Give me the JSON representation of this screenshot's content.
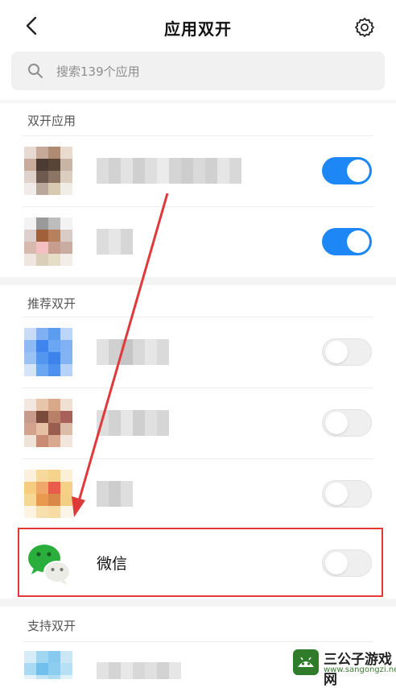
{
  "header": {
    "title": "应用双开",
    "back_icon": "back-icon",
    "settings_icon": "gear-icon"
  },
  "search": {
    "placeholder": "搜索139个应用",
    "icon": "search-icon"
  },
  "sections": [
    {
      "title": "双开应用"
    },
    {
      "title": "推荐双开"
    },
    {
      "title": "支持双开"
    }
  ],
  "apps": {
    "enabled": [
      {
        "name_blurred": true,
        "enabled": true
      },
      {
        "name_blurred": true,
        "enabled": true
      }
    ],
    "recommended": [
      {
        "name_blurred": true,
        "enabled": false
      },
      {
        "name_blurred": true,
        "enabled": false
      },
      {
        "name_blurred": true,
        "enabled": false
      },
      {
        "name": "微信",
        "enabled": false,
        "icon": "wechat-icon"
      }
    ],
    "supported": [
      {
        "name_blurred": true
      }
    ]
  },
  "watermark": {
    "title": "三公子游戏网",
    "url": "www.sangongzi.net"
  },
  "colors": {
    "toggle_on": "#1d87f5",
    "highlight": "#e0393a"
  }
}
